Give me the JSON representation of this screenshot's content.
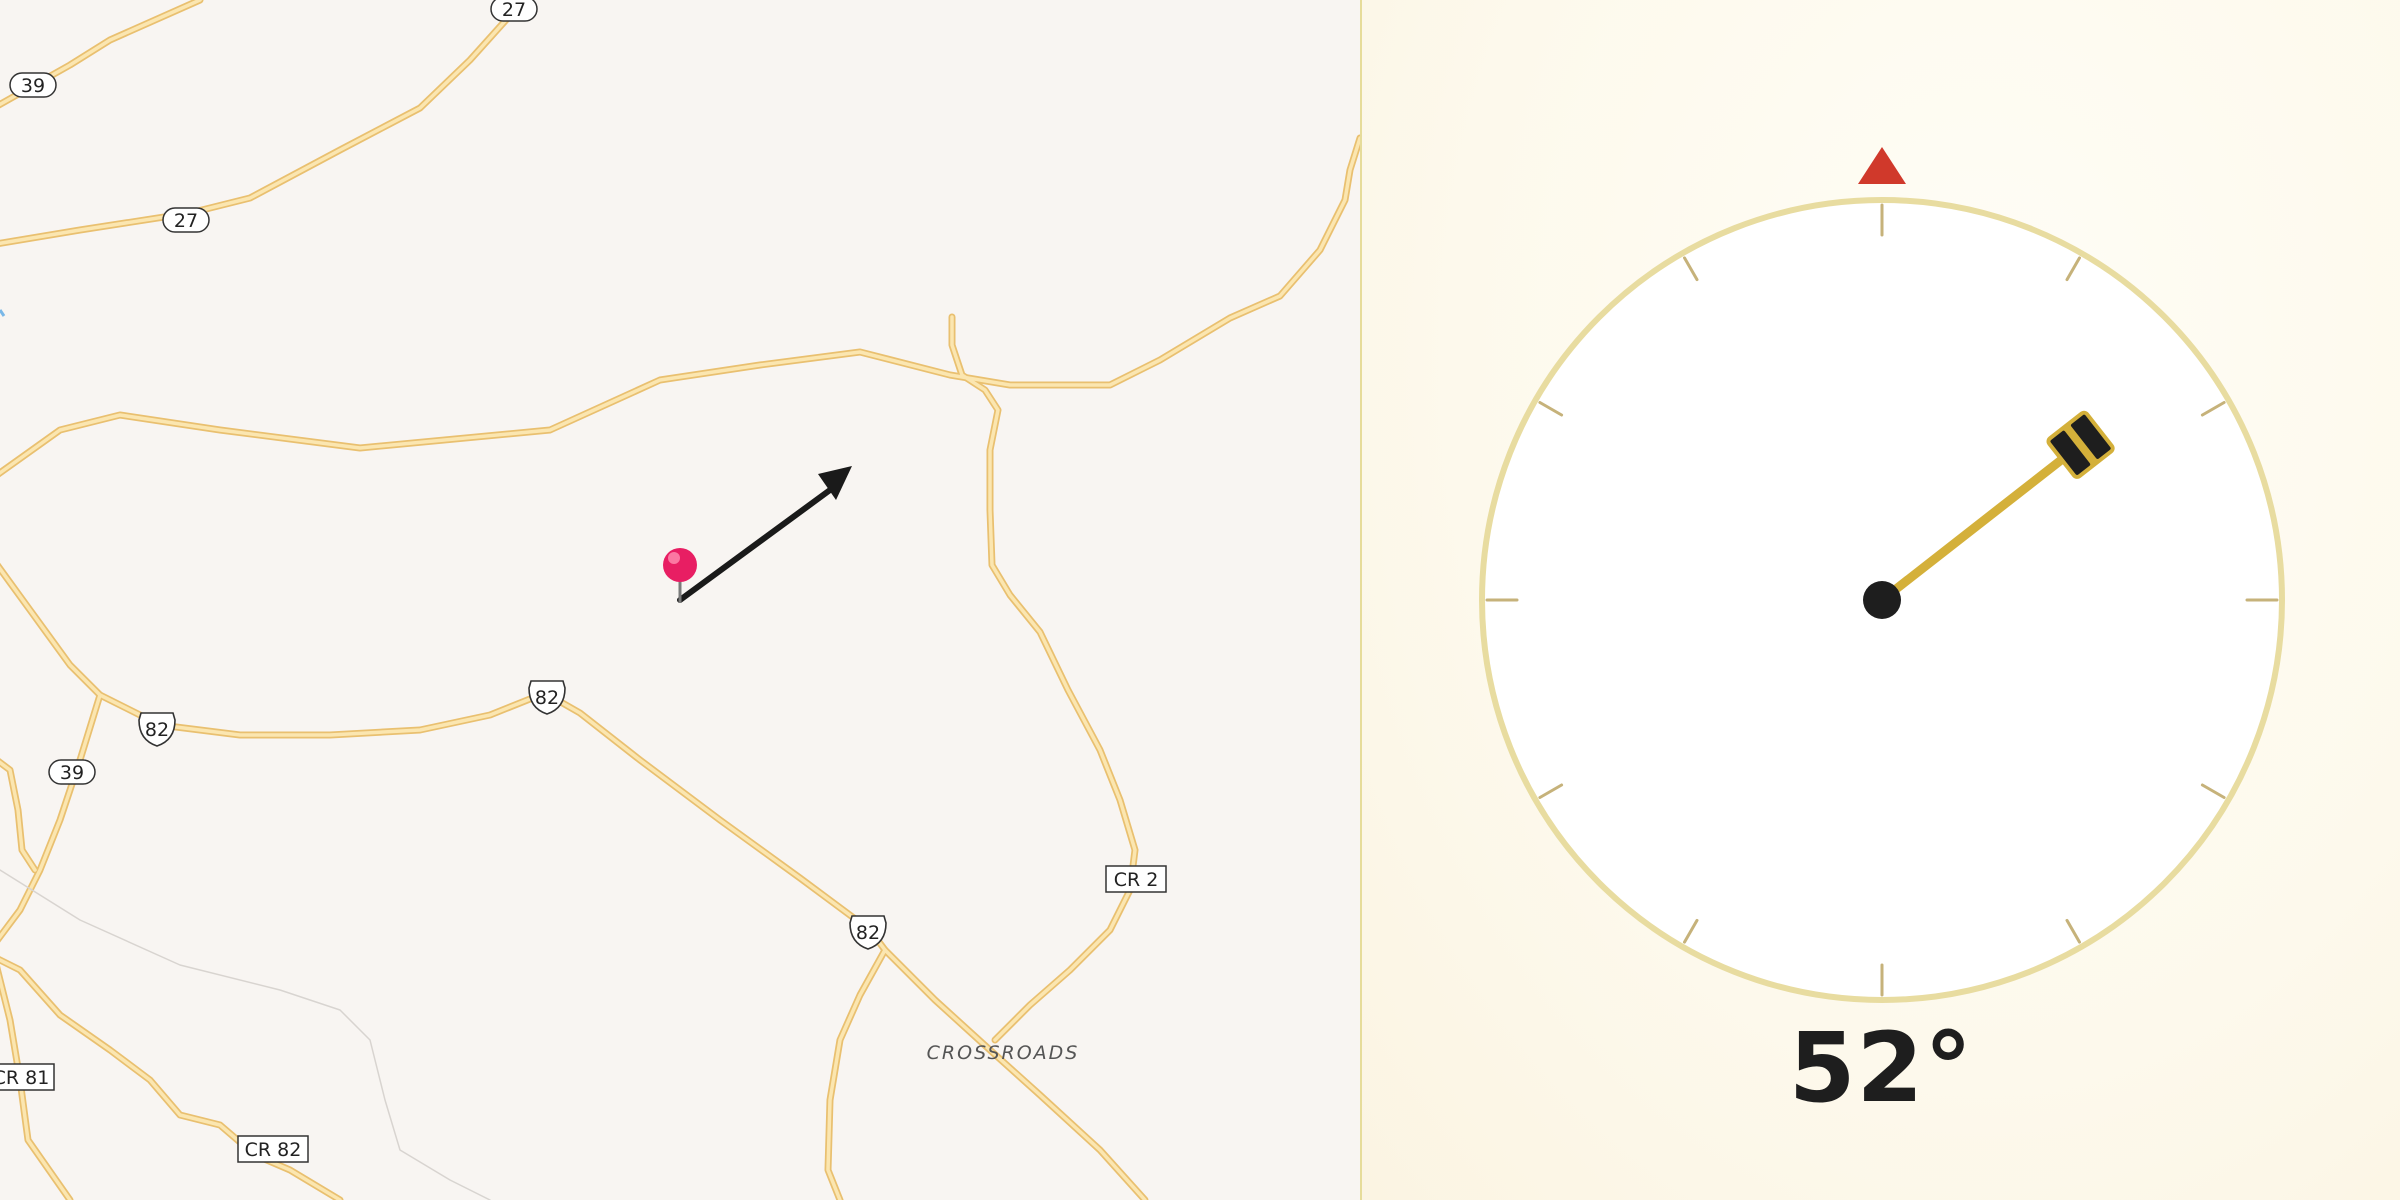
{
  "map": {
    "place_label": "CROSSROADS",
    "route_labels": {
      "r27_top": "27",
      "r39_left": "39",
      "r27_mid": "27",
      "us82_left": "82",
      "us82_mid": "82",
      "us82_low": "82",
      "r39_low": "39",
      "cr2": "CR 2",
      "cr81": "CR 81",
      "cr82": "CR 82"
    },
    "pin_icon": "map-pin-icon",
    "direction_arrow_icon": "direction-arrow-icon",
    "colors": {
      "road": "#f5d58c",
      "road_edge": "#e9c070",
      "pin": "#e81e63",
      "arrow": "#1a1a1a",
      "background": "#f8f5f2"
    }
  },
  "compass": {
    "heading_value": 52,
    "heading_text": "52°",
    "north_marker_icon": "north-triangle-icon",
    "handle_icon": "drag-handle-icon",
    "colors": {
      "ring": "#e8dca0",
      "needle": "#d4b03a",
      "north": "#d0392b",
      "hub": "#1e1e1e"
    }
  }
}
